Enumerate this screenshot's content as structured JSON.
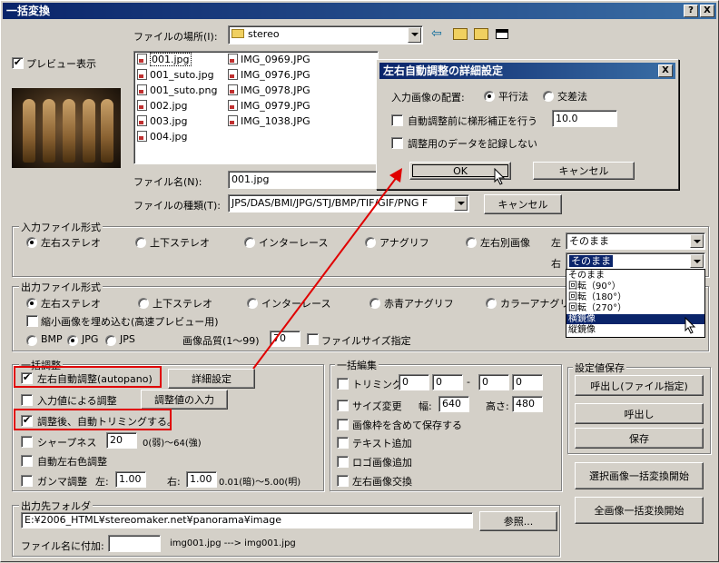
{
  "window": {
    "title": "一括変換",
    "help_btn": "?",
    "close_btn": "X"
  },
  "preview_toggle": {
    "label": "プレビュー表示",
    "checked": true
  },
  "file_location": {
    "label": "ファイルの場所(I):",
    "value": "stereo"
  },
  "files": [
    "001.jpg",
    "001_suto.jpg",
    "001_suto.png",
    "002.jpg",
    "003.jpg",
    "004.jpg",
    "IMG_0969.JPG",
    "IMG_0976.JPG",
    "IMG_0978.JPG",
    "IMG_0979.JPG",
    "IMG_1038.JPG"
  ],
  "file_name": {
    "label": "ファイル名(N):",
    "value": "001.jpg"
  },
  "file_type": {
    "label": "ファイルの種類(T):",
    "value": "JPS/DAS/BMI/JPG/STJ/BMP/TIF/GIF/PNG F"
  },
  "cancel_main": "キャンセル",
  "input_format": {
    "title": "入力ファイル形式",
    "options": [
      "左右ステレオ",
      "上下ステレオ",
      "インターレース",
      "アナグリフ",
      "左右別画像"
    ],
    "selected": 0,
    "left_label": "左",
    "left_value": "そのまま",
    "right_label": "右",
    "right_value": "そのまま"
  },
  "dropdown": {
    "items": [
      "そのまま",
      "回転（90°）",
      "回転（180°）",
      "回転（270°）",
      "横鏡像",
      "縦鏡像"
    ],
    "selected": 4
  },
  "output_format": {
    "title": "出力ファイル形式",
    "options": [
      "左右ステレオ",
      "上下ステレオ",
      "インターレース",
      "赤青アナグリフ",
      "カラーアナグリ"
    ],
    "selected": 0,
    "embed_label": "縮小画像を埋め込む(高速プレビュー用)",
    "types": [
      "BMP",
      "JPG",
      "JPS"
    ],
    "type_selected": 1,
    "quality_label": "画像品質(1〜99)",
    "quality_value": "70",
    "filesize_label": "ファイルサイズ指定"
  },
  "adjust": {
    "title": "一括調整",
    "auto_label": "左右自動調整(autopano)",
    "detail_btn": "詳細設定",
    "input_adjust_label": "入力値による調整",
    "input_adjust_btn": "調整値の入力",
    "auto_trim_label": "調整後、自動トリミングする。",
    "sharpness_label": "シャープネス",
    "sharpness_value": "20",
    "sharpness_range": "0(弱)〜64(強)",
    "auto_color_label": "自動左右色調整",
    "gamma_label": "ガンマ調整",
    "gamma_left_label": "左:",
    "gamma_left": "1.00",
    "gamma_right_label": "右:",
    "gamma_right": "1.00",
    "gamma_range": "0.01(暗)〜5.00(明)"
  },
  "edit": {
    "title": "一括編集",
    "trim_label": "トリミング",
    "trim_values": [
      "0",
      "0",
      "0",
      "0"
    ],
    "trim_dash": "-",
    "resize_label": "サイズ変更",
    "width_label": "幅:",
    "width_value": "640",
    "height_label": "高さ:",
    "height_value": "480",
    "frame_label": "画像枠を含めて保存する",
    "text_label": "テキスト追加",
    "logo_label": "ロゴ画像追加",
    "swap_label": "左右画像交換"
  },
  "settings": {
    "title": "設定値保存",
    "load_file_btn": "呼出し(ファイル指定)",
    "load_btn": "呼出し",
    "save_btn": "保存"
  },
  "start_selected_btn": "選択画像一括変換開始",
  "start_all_btn": "全画像一括変換開始",
  "output_folder": {
    "title": "出力先フォルダ",
    "path": "E:¥2006_HTML¥stereomaker.net¥panorama¥image",
    "browse_btn": "参照...",
    "suffix_label": "ファイル名に付加:",
    "suffix_value": "",
    "example": "img001.jpg ---> img001.jpg"
  },
  "detail_dialog": {
    "title": "左右自動調整の詳細設定",
    "close": "X",
    "layout_label": "入力画像の配置:",
    "layout_options": [
      "平行法",
      "交差法"
    ],
    "layout_selected": 0,
    "trapezoid_label": "自動調整前に梯形補正を行う",
    "trapezoid_value": "10.0",
    "nosave_label": "調整用のデータを記録しない",
    "ok": "OK",
    "cancel": "キャンセル"
  },
  "colors": {
    "title_bar": "#0a246a",
    "face": "#d4d0c8",
    "highlight": "#e00000"
  }
}
